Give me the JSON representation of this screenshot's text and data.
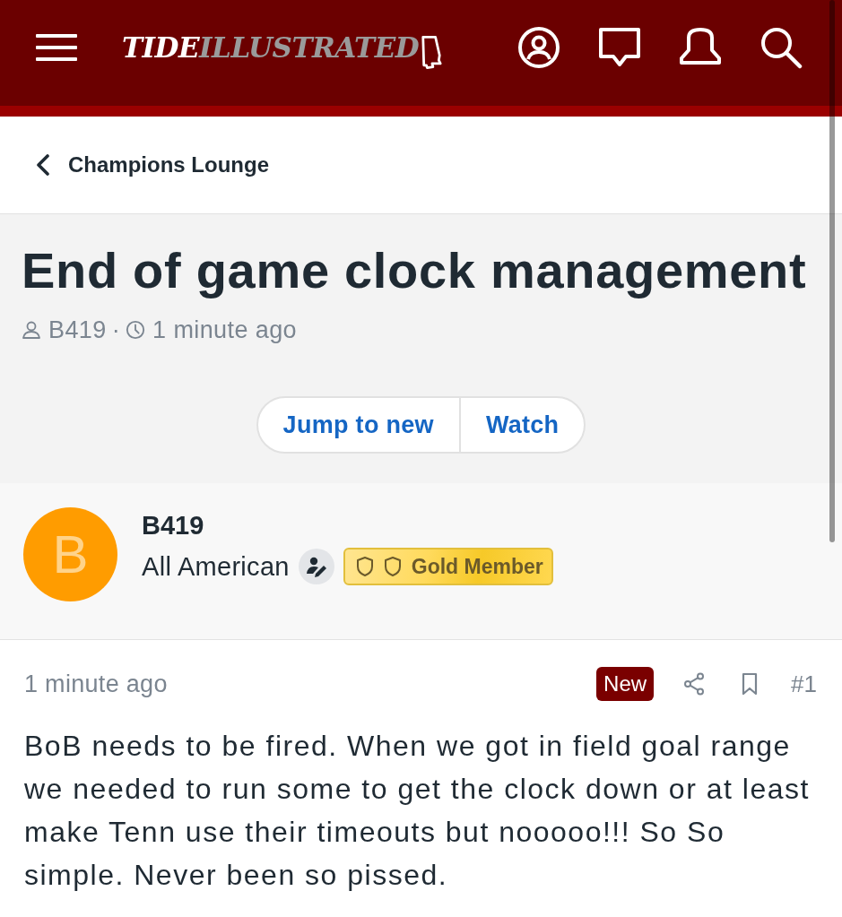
{
  "header": {
    "logo": {
      "word_1": "TIDE",
      "word_2": "ILLUSTRATED"
    }
  },
  "breadcrumb": {
    "label": "Champions Lounge"
  },
  "thread": {
    "title": "End of game clock management",
    "author": "B419",
    "separator": "·",
    "time": "1 minute ago"
  },
  "thread_actions": [
    {
      "label": "Jump to new"
    },
    {
      "label": "Watch"
    }
  ],
  "post": {
    "author": {
      "initial": "B",
      "name": "B419",
      "rank": "All American",
      "badge": "Gold Member"
    },
    "time": "1 minute ago",
    "new_badge": "New",
    "number": "#1",
    "body": "BoB needs to be fired. When we got in field goal range we needed to run some to get the clock down or at least make Tenn use their timeouts but nooooo!!! So So simple. Never been so pissed."
  }
}
